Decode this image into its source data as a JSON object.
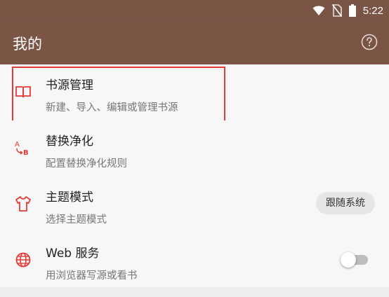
{
  "status_bar": {
    "time": "5:22",
    "icons": [
      "wifi-icon",
      "no-sim-icon",
      "battery-icon"
    ]
  },
  "app_bar": {
    "title": "我的",
    "help_icon": "help-circle-icon"
  },
  "settings": [
    {
      "title": "书源管理",
      "subtitle": "新建、导入、编辑或管理书源",
      "icon": "book-icon",
      "highlighted": true
    },
    {
      "title": "替换净化",
      "subtitle": "配置替换净化规则",
      "icon": "replace-ab-icon"
    },
    {
      "title": "主题模式",
      "subtitle": "选择主题模式",
      "icon": "tshirt-icon",
      "chip_label": "跟随系统"
    },
    {
      "title": "Web 服务",
      "subtitle": "用浏览器写源或看书",
      "icon": "globe-icon",
      "toggle_on": false
    }
  ],
  "colors": {
    "primary": "#7a5546",
    "accent_icon": "#e53935",
    "highlight_border": "#e53935"
  }
}
